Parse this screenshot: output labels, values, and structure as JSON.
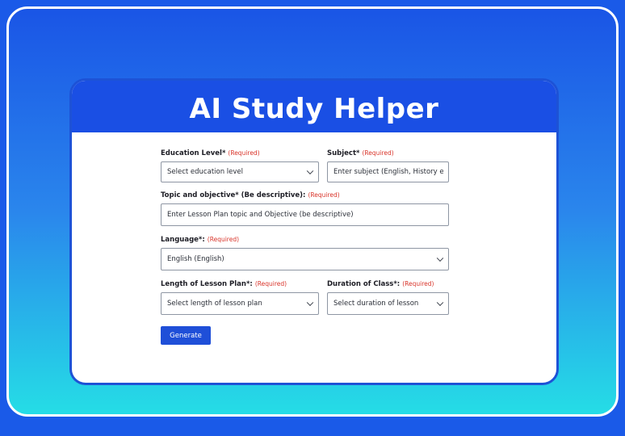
{
  "header": {
    "title": "AI Study Helper"
  },
  "form": {
    "required_tag": "(Required)",
    "education_level": {
      "label": "Education Level*",
      "value": "Select education level"
    },
    "subject": {
      "label": "Subject*",
      "placeholder": "Enter subject (English, History e"
    },
    "topic": {
      "label": "Topic and objective* (Be descriptive):",
      "placeholder": "Enter Lesson Plan topic and Objective (be descriptive)"
    },
    "language": {
      "label": "Language*:",
      "value": "English (English)"
    },
    "length": {
      "label": "Length of Lesson Plan*:",
      "value": "Select length of lesson plan"
    },
    "duration": {
      "label": "Duration of Class*:",
      "value": "Select duration of lesson"
    },
    "generate_label": "Generate"
  },
  "colors": {
    "brand": "#1a4fe4",
    "button": "#1f4fd8",
    "required": "#d9352b"
  }
}
